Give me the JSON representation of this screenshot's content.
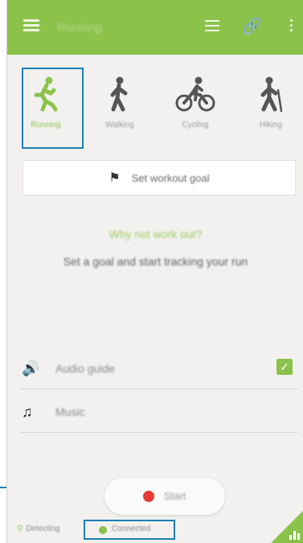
{
  "app_bar": {
    "title": "Running",
    "icons": [
      "menu-icon",
      "list-icon",
      "link-icon",
      "more-icon"
    ],
    "color": "#8bc34a"
  },
  "activities": [
    {
      "label": "Running",
      "icon": "running-icon",
      "selected": true
    },
    {
      "label": "Walking",
      "icon": "walking-icon",
      "selected": false
    },
    {
      "label": "Cycling",
      "icon": "cycling-icon",
      "selected": false
    },
    {
      "label": "Hiking",
      "icon": "hiking-icon",
      "selected": false
    }
  ],
  "goal": {
    "label": "Set workout goal",
    "icon": "flag-icon"
  },
  "prompt": {
    "headline": "Why not work out?",
    "subtext": "Set a goal and start tracking your run"
  },
  "options": [
    {
      "label": "Audio guide",
      "icon": "audio-guide-icon",
      "checked": true
    },
    {
      "label": "Music",
      "icon": "music-icon"
    }
  ],
  "start": {
    "label": "Start"
  },
  "status": {
    "gps": "Detecting",
    "connection": "Connected"
  },
  "colors": {
    "accent": "#8bc34a",
    "highlight": "#1b7fb5",
    "start_dot": "#e53935"
  }
}
